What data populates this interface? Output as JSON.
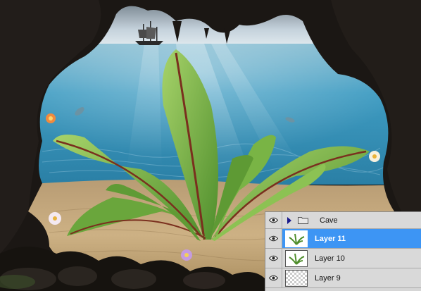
{
  "canvas": {
    "description_icon": "photoshop-canvas",
    "colors": {
      "sky": "#c9d3db",
      "sea": "#3a9bc0",
      "sand": "#c9a876",
      "rock": "#1a1612",
      "leaf": "#7ab648",
      "selection": "#3d95f4"
    }
  },
  "layers_panel": {
    "rows": [
      {
        "name": "Cave",
        "kind": "group",
        "visible": true,
        "selected": false,
        "icon": "folder-icon"
      },
      {
        "name": "Layer 11",
        "kind": "layer",
        "visible": true,
        "selected": true,
        "thumbnail": "plant"
      },
      {
        "name": "Layer 10",
        "kind": "layer",
        "visible": true,
        "selected": false,
        "thumbnail": "plant"
      },
      {
        "name": "Layer 9",
        "kind": "layer",
        "visible": true,
        "selected": false,
        "thumbnail": "transparent"
      }
    ]
  }
}
